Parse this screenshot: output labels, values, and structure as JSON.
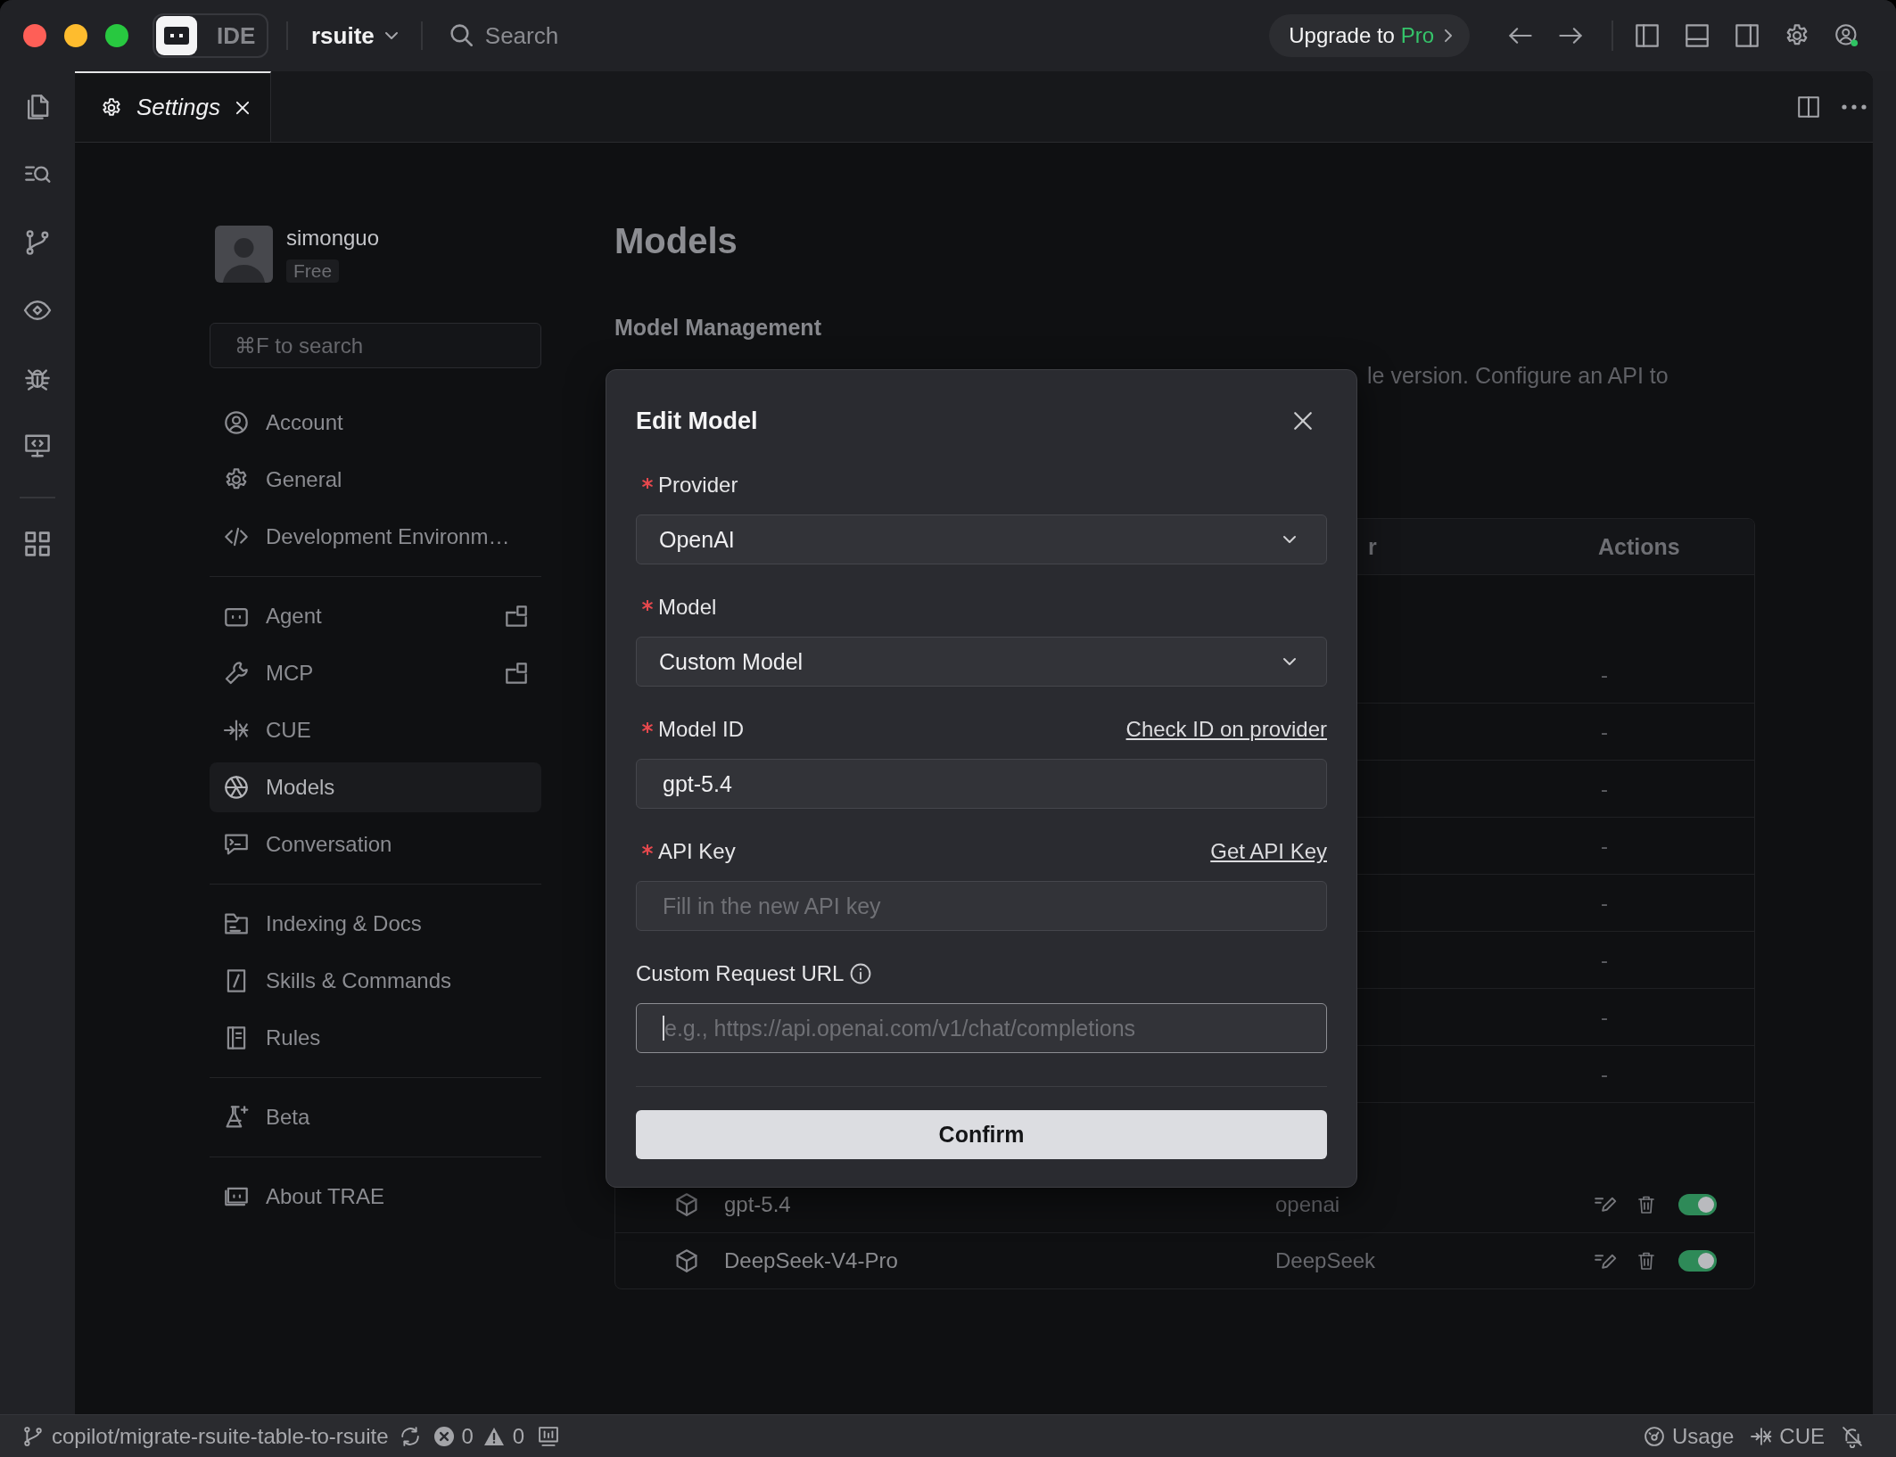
{
  "title_bar": {
    "modes": [
      {
        "kind": "logo",
        "selected": true
      },
      {
        "kind": "text",
        "label": "IDE",
        "selected": false
      }
    ],
    "project": "rsuite",
    "search": {
      "placeholder": "Search"
    },
    "upgrade": {
      "text": "Upgrade to",
      "highlight": "Pro"
    }
  },
  "tabs": [
    {
      "label": "Settings",
      "selected": true
    }
  ],
  "settings_nav": {
    "user": {
      "name": "simonguo",
      "plan": "Free"
    },
    "search": {
      "placeholder": "⌘F to search"
    },
    "groups": [
      [
        {
          "label": "Account",
          "selected": false,
          "popout": false
        },
        {
          "label": "General",
          "selected": false,
          "popout": false
        },
        {
          "label": "Development Environm…",
          "selected": false,
          "popout": false
        }
      ],
      [
        {
          "label": "Agent",
          "selected": false,
          "popout": true
        },
        {
          "label": "MCP",
          "selected": false,
          "popout": true
        },
        {
          "label": "CUE",
          "selected": false,
          "popout": false
        },
        {
          "label": "Models",
          "selected": true,
          "popout": false
        },
        {
          "label": "Conversation",
          "selected": false,
          "popout": false
        }
      ],
      [
        {
          "label": "Indexing & Docs",
          "selected": false,
          "popout": false
        },
        {
          "label": "Skills & Commands",
          "selected": false,
          "popout": false
        },
        {
          "label": "Rules",
          "selected": false,
          "popout": false
        }
      ],
      [
        {
          "label": "Beta",
          "selected": false,
          "popout": false
        }
      ],
      [
        {
          "label": "About TRAE",
          "selected": false,
          "popout": false
        }
      ]
    ]
  },
  "main": {
    "title": "Models",
    "section_title": "Model Management",
    "description": "le version. Configure an API to",
    "table": {
      "columns": [
        "r",
        "Actions"
      ],
      "builtin_rows": [
        {
          "actions": "-"
        },
        {
          "actions": "-"
        },
        {
          "actions": "-"
        },
        {
          "actions": "-"
        },
        {
          "actions": "-"
        },
        {
          "actions": "-"
        },
        {
          "actions": "-"
        },
        {
          "actions": "-"
        }
      ],
      "custom_rows": [
        {
          "name": "gpt-5.4",
          "provider": "openai",
          "on": true
        },
        {
          "name": "DeepSeek-V4-Pro",
          "provider": "DeepSeek",
          "on": true
        }
      ]
    }
  },
  "dialog": {
    "title": "Edit Model",
    "fields": [
      {
        "kind": "select",
        "label": "Provider",
        "required": true,
        "info": false,
        "focused": false,
        "value": "OpenAI"
      },
      {
        "kind": "select",
        "label": "Model",
        "required": true,
        "info": false,
        "focused": false,
        "value": "Custom Model"
      },
      {
        "kind": "input",
        "label": "Model ID",
        "required": true,
        "info": false,
        "focused": false,
        "value": "gpt-5.4",
        "link": "Check ID on provider"
      },
      {
        "kind": "input",
        "label": "API Key",
        "required": true,
        "info": false,
        "focused": false,
        "placeholder": "Fill in the new API key",
        "link": "Get API Key"
      },
      {
        "kind": "input",
        "label": "Custom Request URL",
        "required": false,
        "info": true,
        "focused": true,
        "placeholder": "e.g., https://api.openai.com/v1/chat/completions"
      }
    ],
    "confirm": "Confirm"
  },
  "status_bar": {
    "branch": "copilot/migrate-rsuite-table-to-rsuite",
    "errors": "0",
    "warnings": "0",
    "items": [
      {
        "label": "Usage"
      },
      {
        "label": "CUE"
      }
    ]
  }
}
